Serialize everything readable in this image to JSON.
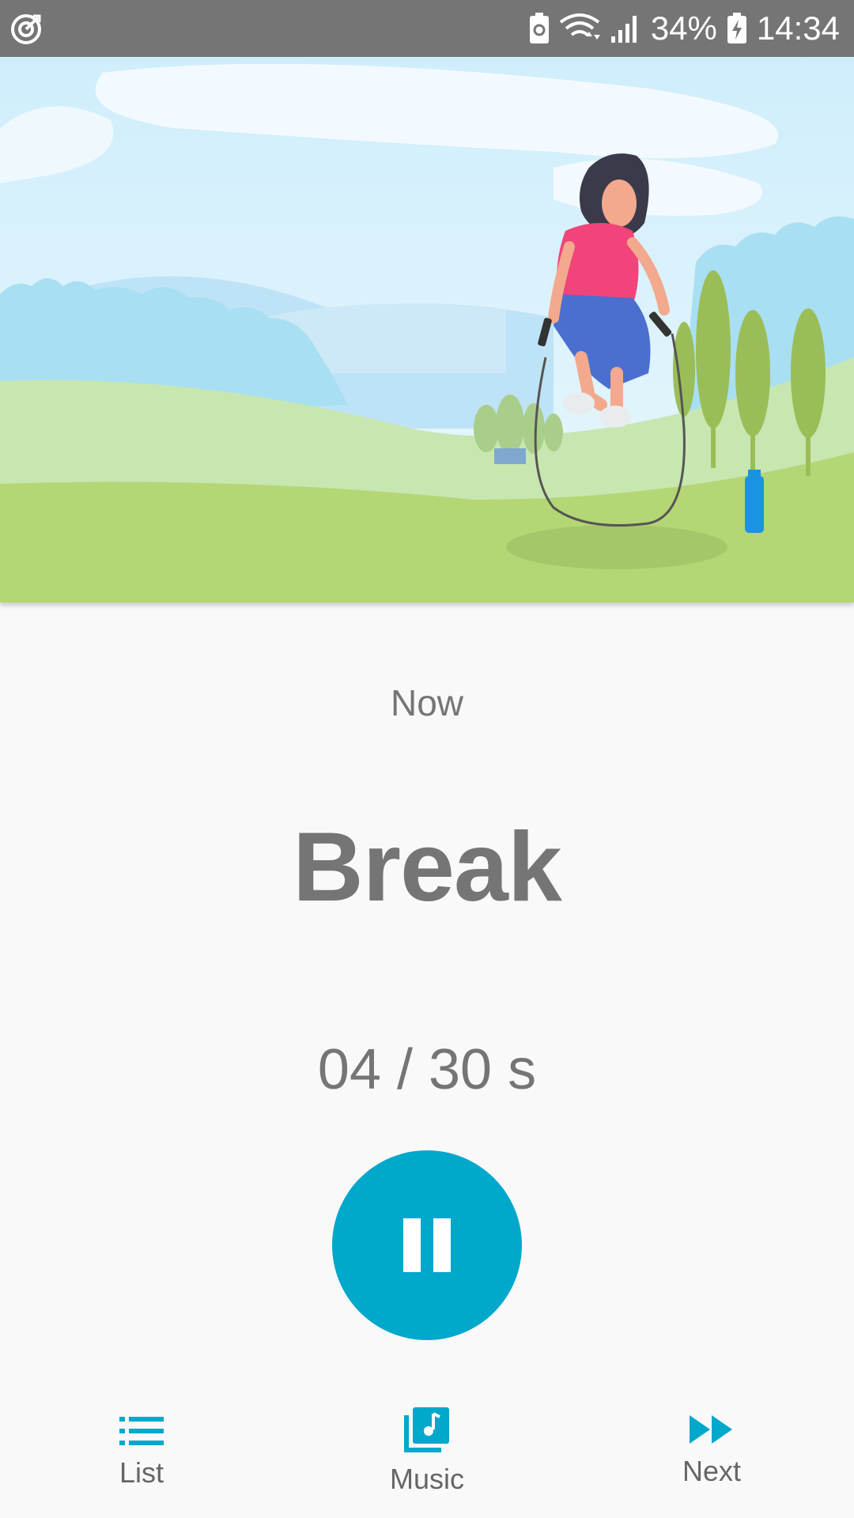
{
  "status_bar": {
    "battery_percent": "34%",
    "time": "14:34",
    "icons": [
      "target-icon",
      "battery-saver-icon",
      "wifi-icon",
      "signal-icon",
      "charging-battery-icon"
    ]
  },
  "workout": {
    "now_label": "Now",
    "exercise_name": "Break",
    "timer_text": "04 / 30 s",
    "elapsed_seconds": 4,
    "total_seconds": 30
  },
  "controls": {
    "play_pause_icon": "pause-icon"
  },
  "bottom_nav": {
    "list": {
      "label": "List",
      "icon": "list-icon"
    },
    "music": {
      "label": "Music",
      "icon": "music-library-icon"
    },
    "next": {
      "label": "Next",
      "icon": "fast-forward-icon"
    }
  },
  "colors": {
    "accent": "#00a8cc",
    "status_bar": "#757575",
    "text": "#757575",
    "background": "#f9f9f9"
  }
}
